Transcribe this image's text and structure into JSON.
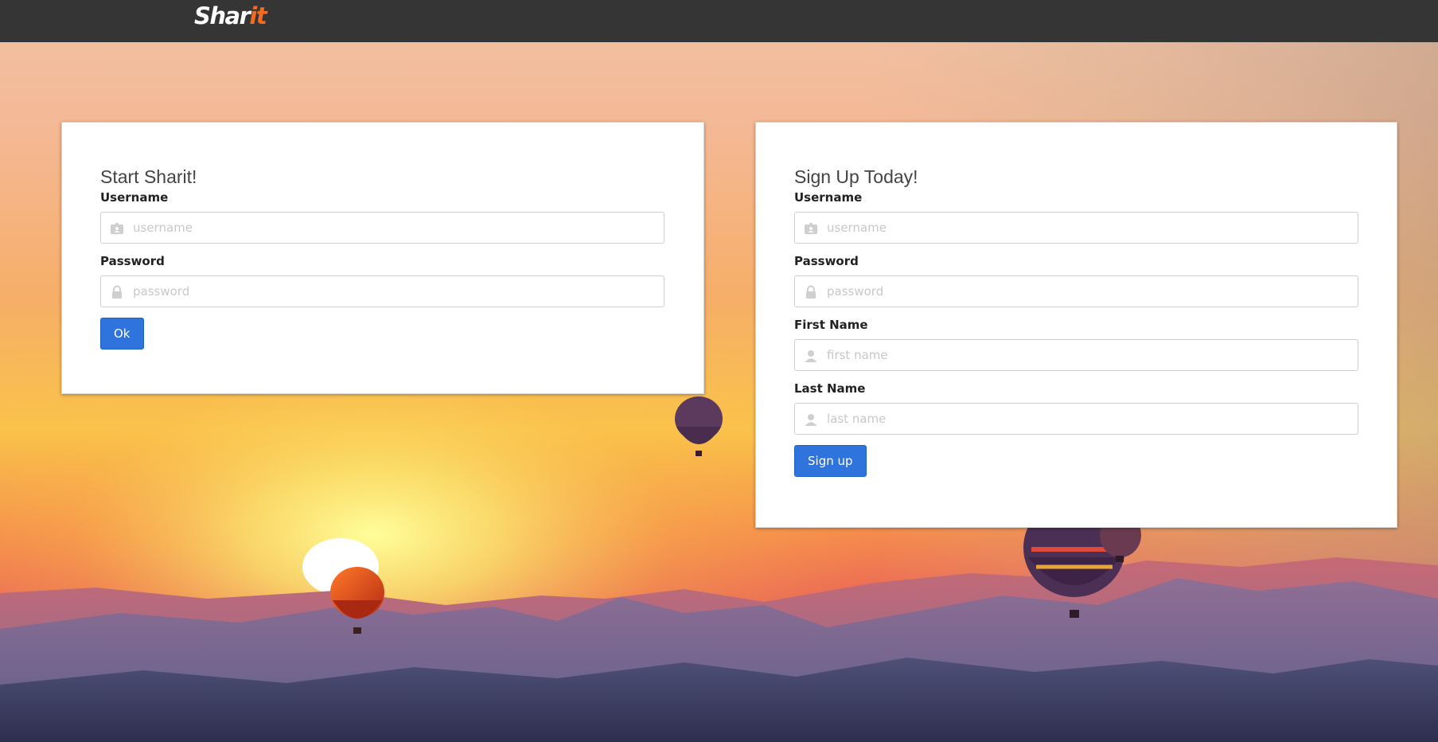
{
  "nav": {
    "logo_part1": "Shar",
    "logo_part2": "it",
    "background": "#353535",
    "logo_accent": "#f26b21"
  },
  "login": {
    "title": "Start Sharit!",
    "username_label": "Username",
    "username_placeholder": "username",
    "username_icon": "id-card-icon",
    "password_label": "Password",
    "password_placeholder": "password",
    "password_icon": "lock-icon",
    "submit_label": "Ok"
  },
  "signup": {
    "title": "Sign Up Today!",
    "username_label": "Username",
    "username_placeholder": "username",
    "password_label": "Password",
    "password_placeholder": "password",
    "first_name_label": "First Name",
    "first_name_placeholder": "first name",
    "last_name_label": "Last Name",
    "last_name_placeholder": "last name",
    "name_icon": "user-icon",
    "submit_label": "Sign up"
  },
  "colors": {
    "button": "#2f74dc",
    "card": "#ffffff"
  }
}
